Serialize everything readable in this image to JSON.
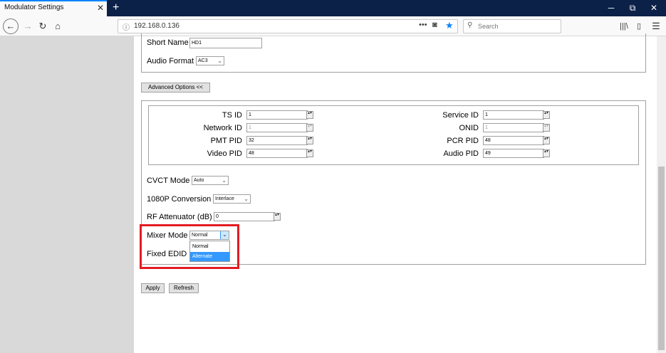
{
  "browser": {
    "tab_title": "Modulator Settings",
    "new_tab": "+",
    "url": "192.168.0.136",
    "search_placeholder": "Search",
    "win_min": "─",
    "win_restore": "⧉",
    "win_close": "✕"
  },
  "basic": {
    "short_name_label": "Short Name",
    "short_name_value": "HD1",
    "audio_format_label": "Audio Format",
    "audio_format_value": "AC3"
  },
  "advanced_button": "Advanced Options <<",
  "pids": {
    "ts_id_label": "TS ID",
    "ts_id_value": "1",
    "network_id_label": "Network ID",
    "network_id_value": "1",
    "pmt_pid_label": "PMT PID",
    "pmt_pid_value": "32",
    "video_pid_label": "Video PID",
    "video_pid_value": "48",
    "service_id_label": "Service ID",
    "service_id_value": "1",
    "onid_label": "ONID",
    "onid_value": "1",
    "pcr_pid_label": "PCR PID",
    "pcr_pid_value": "48",
    "audio_pid_label": "Audio PID",
    "audio_pid_value": "49"
  },
  "settings": {
    "cvct_label": "CVCT Mode",
    "cvct_value": "Auto",
    "conv_label": "1080P Conversion",
    "conv_value": "Interlace",
    "rf_label": "RF Attenuator (dB)",
    "rf_value": "0",
    "mixer_label": "Mixer Mode",
    "mixer_value": "Normal",
    "mixer_options": [
      "Normal",
      "Alternate"
    ],
    "edid_label": "Fixed EDID"
  },
  "actions": {
    "apply": "Apply",
    "refresh": "Refresh"
  },
  "colors": {
    "highlight": "#e31b23",
    "selected_option": "#3399ff"
  }
}
